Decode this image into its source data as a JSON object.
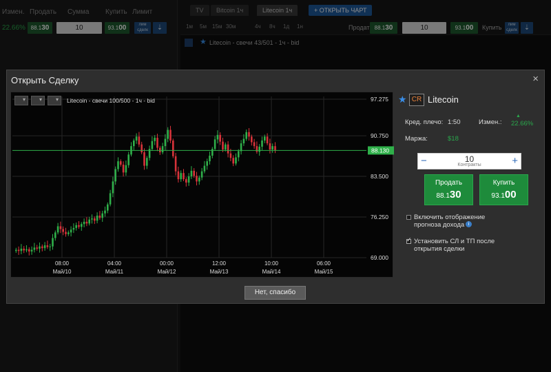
{
  "background": {
    "headers": [
      "Измен.",
      "Продать",
      "Сумма",
      "Купить",
      "Лимит"
    ],
    "change_value": "22.66%",
    "sell_price_small": "88.1",
    "sell_price_big": "30",
    "amount": "10",
    "buy_price_small": "93.1",
    "buy_price_big": "00",
    "limit_label": "лим сделк",
    "tabs": [
      "TV",
      "Bitcoin 1ч",
      "Litecoin 1ч"
    ],
    "open_chart_button": "+ ОТКРЫТЬ ЧАРТ",
    "timeframes": [
      "1м",
      "5м",
      "15м",
      "30м",
      "4ч",
      "8ч",
      "1д",
      "1н"
    ],
    "chart_sell_label": "Продать",
    "chart_buy_label": "Купить",
    "chart_caption": "Litecoin - свечи 43/501 - 1ч - bid"
  },
  "modal": {
    "title": "Открыть Сделку",
    "close_glyph": "×",
    "chart": {
      "caption": "Litecoin - свечи 100/500 - 1ч - bid",
      "current_price_label": "88.130"
    },
    "asset": {
      "icon_text": "CR",
      "name": "Litecoin"
    },
    "leverage_label": "Кред. плечо:",
    "leverage_value": "1:50",
    "change_label": "Измен.:",
    "change_value": "22.66%",
    "margin_label": "Маржа:",
    "margin_value": "$18",
    "stepper": {
      "minus": "−",
      "plus": "+",
      "value": "10",
      "label": "Контракты"
    },
    "sell": {
      "label": "Продать",
      "price_small": "88.1",
      "price_big": "30"
    },
    "buy": {
      "label": "Купить",
      "price_small": "93.1",
      "price_big": "00"
    },
    "option_forecast_line1": "Включить отображение",
    "option_forecast_line2": "прогноза дохода",
    "option_sltp_line1": "Установить СЛ и ТП после",
    "option_sltp_line2": "открытия сделки",
    "footer_button": "Нет, спасибо"
  },
  "chart_data": {
    "type": "candlestick",
    "y_ticks": [
      69.0,
      76.25,
      83.5,
      90.75,
      97.275
    ],
    "y_tick_labels": [
      "69.000",
      "76.250",
      "83.500",
      "90.750",
      "97.275"
    ],
    "ylim": [
      69.0,
      97.275
    ],
    "x_ticks": [
      {
        "time": "08:00",
        "date": "Май/10"
      },
      {
        "time": "04:00",
        "date": "Май/11"
      },
      {
        "time": "00:00",
        "date": "Май/12"
      },
      {
        "time": "12:00",
        "date": "Май/13"
      },
      {
        "time": "10:00",
        "date": "Май/14"
      },
      {
        "time": "06:00",
        "date": "Май/15"
      }
    ],
    "current_price": 88.13,
    "closes": [
      70.4,
      70.2,
      70.6,
      70.3,
      70.5,
      70.1,
      70.4,
      70.8,
      70.6,
      71.0,
      70.7,
      71.2,
      70.9,
      71.0,
      72.5,
      73.5,
      74.6,
      74.1,
      73.6,
      73.2,
      73.5,
      74.0,
      74.3,
      74.8,
      74.5,
      75.0,
      75.4,
      75.1,
      75.8,
      76.0,
      75.6,
      76.5,
      76.1,
      76.9,
      77.4,
      78.5,
      80.5,
      82.6,
      84.8,
      86.2,
      85.6,
      84.2,
      85.5,
      87.4,
      88.9,
      89.9,
      90.6,
      89.2,
      87.8,
      85.4,
      86.8,
      88.4,
      89.8,
      90.4,
      88.6,
      87.8,
      88.9,
      90.2,
      91.8,
      89.9,
      87.1,
      84.4,
      83.0,
      84.1,
      83.0,
      82.4,
      83.5,
      84.5,
      83.6,
      82.6,
      83.3,
      84.4,
      85.4,
      86.2,
      87.2,
      88.4,
      90.1,
      90.9,
      89.7,
      88.3,
      89.2,
      87.6,
      86.8,
      85.8,
      86.9,
      88.0,
      89.4,
      90.2,
      91.4,
      90.6,
      89.6,
      88.9,
      87.9,
      88.8,
      89.9,
      90.6,
      89.4,
      88.3,
      88.9,
      88.13
    ]
  }
}
